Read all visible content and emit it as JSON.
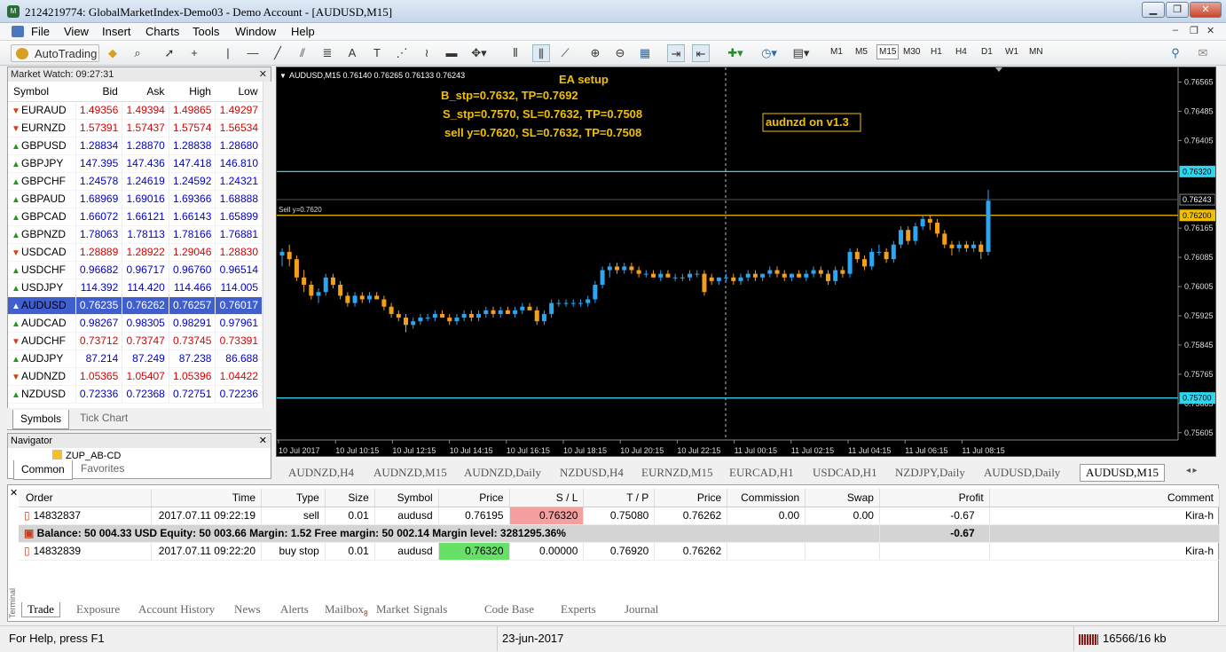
{
  "window": {
    "title": "2124219774: GlobalMarketIndex-Demo03 - Demo Account - [AUDUSD,M15]"
  },
  "menu": [
    "File",
    "View",
    "Insert",
    "Charts",
    "Tools",
    "Window",
    "Help"
  ],
  "toolbar": {
    "autotrading": "AutoTrading",
    "timeframes": [
      "M1",
      "M5",
      "M15",
      "M30",
      "H1",
      "H4",
      "D1",
      "W1",
      "MN"
    ],
    "active_tf": "M15"
  },
  "market_watch": {
    "title": "Market Watch: 09:27:31",
    "headers": [
      "Symbol",
      "Bid",
      "Ask",
      "High",
      "Low"
    ],
    "rows": [
      {
        "sym": "EURAUD",
        "bid": "1.49356",
        "ask": "1.49394",
        "high": "1.49865",
        "low": "1.49297",
        "dir": "down"
      },
      {
        "sym": "EURNZD",
        "bid": "1.57391",
        "ask": "1.57437",
        "high": "1.57574",
        "low": "1.56534",
        "dir": "down"
      },
      {
        "sym": "GBPUSD",
        "bid": "1.28834",
        "ask": "1.28870",
        "high": "1.28838",
        "low": "1.28680",
        "dir": "up"
      },
      {
        "sym": "GBPJPY",
        "bid": "147.395",
        "ask": "147.436",
        "high": "147.418",
        "low": "146.810",
        "dir": "up"
      },
      {
        "sym": "GBPCHF",
        "bid": "1.24578",
        "ask": "1.24619",
        "high": "1.24592",
        "low": "1.24321",
        "dir": "up"
      },
      {
        "sym": "GBPAUD",
        "bid": "1.68969",
        "ask": "1.69016",
        "high": "1.69366",
        "low": "1.68888",
        "dir": "up"
      },
      {
        "sym": "GBPCAD",
        "bid": "1.66072",
        "ask": "1.66121",
        "high": "1.66143",
        "low": "1.65899",
        "dir": "up"
      },
      {
        "sym": "GBPNZD",
        "bid": "1.78063",
        "ask": "1.78113",
        "high": "1.78166",
        "low": "1.76881",
        "dir": "up"
      },
      {
        "sym": "USDCAD",
        "bid": "1.28889",
        "ask": "1.28922",
        "high": "1.29046",
        "low": "1.28830",
        "dir": "down"
      },
      {
        "sym": "USDCHF",
        "bid": "0.96682",
        "ask": "0.96717",
        "high": "0.96760",
        "low": "0.96514",
        "dir": "up"
      },
      {
        "sym": "USDJPY",
        "bid": "114.392",
        "ask": "114.420",
        "high": "114.466",
        "low": "114.005",
        "dir": "up"
      },
      {
        "sym": "AUDUSD",
        "bid": "0.76235",
        "ask": "0.76262",
        "high": "0.76257",
        "low": "0.76017",
        "dir": "up",
        "selected": true
      },
      {
        "sym": "AUDCAD",
        "bid": "0.98267",
        "ask": "0.98305",
        "high": "0.98291",
        "low": "0.97961",
        "dir": "up"
      },
      {
        "sym": "AUDCHF",
        "bid": "0.73712",
        "ask": "0.73747",
        "high": "0.73745",
        "low": "0.73391",
        "dir": "down"
      },
      {
        "sym": "AUDJPY",
        "bid": "87.214",
        "ask": "87.249",
        "high": "87.238",
        "low": "86.688",
        "dir": "up"
      },
      {
        "sym": "AUDNZD",
        "bid": "1.05365",
        "ask": "1.05407",
        "high": "1.05396",
        "low": "1.04422",
        "dir": "down"
      },
      {
        "sym": "NZDUSD",
        "bid": "0.72336",
        "ask": "0.72368",
        "high": "0.72751",
        "low": "0.72236",
        "dir": "up"
      }
    ],
    "tabs": [
      "Symbols",
      "Tick Chart"
    ]
  },
  "navigator": {
    "title": "Navigator",
    "item": "ZUP_AB-CD",
    "tabs": [
      "Common",
      "Favorites"
    ]
  },
  "chart": {
    "header": "AUDUSD,M15  0.76140 0.76265 0.76133 0.76243",
    "ea_setup": [
      "EA setup",
      "B_stp=0.7632, TP=0.7692",
      "S_stp=0.7570, SL=0.7632, TP=0.7508",
      "sell y=0.7620, SL=0.7632, TP=0.7508"
    ],
    "note": "audnzd on v1.3",
    "sell_label": "Sell y=0.7620",
    "price_axis": [
      "0.76565",
      "0.76485",
      "0.76405",
      "0.76165",
      "0.76085",
      "0.76005",
      "0.75925",
      "0.75845",
      "0.75765",
      "0.75685",
      "0.75605"
    ],
    "price_tags": {
      "upper": "0.76320",
      "current": "0.76243",
      "sell": "0.76200",
      "lower": "0.75700"
    },
    "time_axis": [
      "10 Jul 2017",
      "10 Jul 10:15",
      "10 Jul 12:15",
      "10 Jul 14:15",
      "10 Jul 16:15",
      "10 Jul 18:15",
      "10 Jul 20:15",
      "10 Jul 22:15",
      "11 Jul 00:15",
      "11 Jul 02:15",
      "11 Jul 04:15",
      "11 Jul 06:15",
      "11 Jul 08:15"
    ],
    "colors": {
      "bull": "#2aa6f2",
      "bear": "#f2a01a",
      "cyan": "#2fd6f0",
      "gold": "#f0c000"
    }
  },
  "chart_tabs": [
    "AUDNZD,H4",
    "AUDNZD,M15",
    "AUDNZD,Daily",
    "NZDUSD,H4",
    "EURNZD,M15",
    "EURCAD,H1",
    "USDCAD,H1",
    "NZDJPY,Daily",
    "AUDUSD,Daily",
    "AUDUSD,M15"
  ],
  "terminal": {
    "headers": [
      "Order",
      "Time",
      "Type",
      "Size",
      "Symbol",
      "Price",
      "S / L",
      "T / P",
      "Price",
      "Commission",
      "Swap",
      "Profit",
      "Comment"
    ],
    "orders": [
      {
        "order": "14832837",
        "time": "2017.07.11 09:22:19",
        "type": "sell",
        "size": "0.01",
        "symbol": "audusd",
        "price": "0.76195",
        "sl": "0.76320",
        "tp": "0.75080",
        "cur": "0.76262",
        "commission": "0.00",
        "swap": "0.00",
        "profit": "-0.67",
        "comment": "Kira-h"
      },
      {
        "order": "14832839",
        "time": "2017.07.11 09:22:20",
        "type": "buy stop",
        "size": "0.01",
        "symbol": "audusd",
        "price": "0.76320",
        "sl": "0.00000",
        "tp": "0.76920",
        "cur": "0.76262",
        "commission": "",
        "swap": "",
        "profit": "",
        "comment": "Kira-h"
      }
    ],
    "balance": "Balance: 50 004.33 USD  Equity: 50 003.66  Margin: 1.52  Free margin: 50 002.14  Margin level: 3281295.36%",
    "balance_profit": "-0.67",
    "tabs": [
      "Trade",
      "Exposure",
      "Account History",
      "News",
      "Alerts",
      "Mailbox",
      "Market",
      "Signals",
      "Code Base",
      "Experts",
      "Journal"
    ],
    "mailbox_badge": "8",
    "side_label": "Terminal"
  },
  "status": {
    "help": "For Help, press F1",
    "date": "23-jun-2017",
    "traffic": "16566/16 kb"
  },
  "candles": [
    [
      0.7609,
      0.7611,
      0.7606,
      0.761
    ],
    [
      0.761,
      0.7612,
      0.7606,
      0.7608
    ],
    [
      0.7608,
      0.7609,
      0.7602,
      0.7603
    ],
    [
      0.7603,
      0.7605,
      0.7599,
      0.7601
    ],
    [
      0.7601,
      0.7602,
      0.7597,
      0.7598
    ],
    [
      0.7598,
      0.76,
      0.7596,
      0.7599
    ],
    [
      0.7599,
      0.7604,
      0.7598,
      0.7603
    ],
    [
      0.7603,
      0.7604,
      0.76,
      0.7601
    ],
    [
      0.7601,
      0.7602,
      0.7597,
      0.7598
    ],
    [
      0.7598,
      0.7599,
      0.7595,
      0.7596
    ],
    [
      0.7596,
      0.7599,
      0.7595,
      0.7598
    ],
    [
      0.7598,
      0.7599,
      0.7596,
      0.7597
    ],
    [
      0.7597,
      0.7599,
      0.7596,
      0.7598
    ],
    [
      0.7598,
      0.7599,
      0.7597,
      0.7597
    ],
    [
      0.7597,
      0.7598,
      0.7594,
      0.7595
    ],
    [
      0.7595,
      0.7596,
      0.7592,
      0.7593
    ],
    [
      0.7593,
      0.7594,
      0.7591,
      0.7592
    ],
    [
      0.7592,
      0.7593,
      0.7588,
      0.759
    ],
    [
      0.759,
      0.7592,
      0.7589,
      0.7591
    ],
    [
      0.7591,
      0.7593,
      0.759,
      0.7592
    ],
    [
      0.7592,
      0.7593,
      0.7591,
      0.7592
    ],
    [
      0.7592,
      0.7594,
      0.7591,
      0.7593
    ],
    [
      0.7593,
      0.7594,
      0.7592,
      0.7592
    ],
    [
      0.7592,
      0.7593,
      0.759,
      0.7591
    ],
    [
      0.7591,
      0.7593,
      0.759,
      0.7592
    ],
    [
      0.7592,
      0.7594,
      0.7591,
      0.7593
    ],
    [
      0.7593,
      0.7594,
      0.7591,
      0.7592
    ],
    [
      0.7592,
      0.7594,
      0.7591,
      0.7593
    ],
    [
      0.7593,
      0.7595,
      0.7592,
      0.7594
    ],
    [
      0.7594,
      0.7595,
      0.7592,
      0.7593
    ],
    [
      0.7593,
      0.7595,
      0.7592,
      0.7594
    ],
    [
      0.7594,
      0.7595,
      0.7593,
      0.7593
    ],
    [
      0.7593,
      0.7595,
      0.7592,
      0.7594
    ],
    [
      0.7594,
      0.7596,
      0.7593,
      0.7595
    ],
    [
      0.7595,
      0.7596,
      0.7594,
      0.7594
    ],
    [
      0.7594,
      0.7595,
      0.759,
      0.7591
    ],
    [
      0.7591,
      0.7594,
      0.759,
      0.7593
    ],
    [
      0.7593,
      0.7597,
      0.7592,
      0.7596
    ],
    [
      0.7596,
      0.7597,
      0.7595,
      0.7596
    ],
    [
      0.7596,
      0.7597,
      0.7595,
      0.7596
    ],
    [
      0.7596,
      0.7597,
      0.7595,
      0.7596
    ],
    [
      0.7596,
      0.7597,
      0.7595,
      0.7596
    ],
    [
      0.7596,
      0.7598,
      0.7595,
      0.7597
    ],
    [
      0.7597,
      0.7602,
      0.7596,
      0.7601
    ],
    [
      0.7601,
      0.7606,
      0.76,
      0.7605
    ],
    [
      0.7605,
      0.7607,
      0.7603,
      0.7606
    ],
    [
      0.7606,
      0.7607,
      0.7604,
      0.7605
    ],
    [
      0.7605,
      0.7607,
      0.7604,
      0.7606
    ],
    [
      0.7606,
      0.7607,
      0.7604,
      0.7605
    ],
    [
      0.7605,
      0.7606,
      0.7603,
      0.7604
    ],
    [
      0.7604,
      0.7605,
      0.7603,
      0.7604
    ],
    [
      0.7604,
      0.7605,
      0.7603,
      0.7603
    ],
    [
      0.7603,
      0.7605,
      0.7602,
      0.7604
    ],
    [
      0.7604,
      0.7605,
      0.7603,
      0.7603
    ],
    [
      0.7603,
      0.7604,
      0.7602,
      0.7603
    ],
    [
      0.7603,
      0.7604,
      0.7602,
      0.7603
    ],
    [
      0.7603,
      0.7605,
      0.7602,
      0.7604
    ],
    [
      0.7604,
      0.7605,
      0.7603,
      0.7604
    ],
    [
      0.7604,
      0.7605,
      0.7598,
      0.7599
    ],
    [
      0.7603,
      0.7604,
      0.7601,
      0.7602
    ],
    [
      0.7602,
      0.7603,
      0.7601,
      0.7603
    ],
    [
      0.7603,
      0.7604,
      0.7602,
      0.7603
    ],
    [
      0.7603,
      0.7604,
      0.7601,
      0.7602
    ],
    [
      0.7602,
      0.7604,
      0.7601,
      0.7603
    ],
    [
      0.7603,
      0.7605,
      0.7602,
      0.7604
    ],
    [
      0.7604,
      0.7605,
      0.7602,
      0.7603
    ],
    [
      0.7603,
      0.7604,
      0.7602,
      0.7604
    ],
    [
      0.7604,
      0.7606,
      0.7603,
      0.7605
    ],
    [
      0.7605,
      0.7606,
      0.7603,
      0.7604
    ],
    [
      0.7604,
      0.7605,
      0.7602,
      0.7603
    ],
    [
      0.7603,
      0.7604,
      0.7602,
      0.7604
    ],
    [
      0.7604,
      0.7605,
      0.7603,
      0.7603
    ],
    [
      0.7603,
      0.7605,
      0.7602,
      0.7604
    ],
    [
      0.7604,
      0.7606,
      0.7603,
      0.7605
    ],
    [
      0.7605,
      0.7606,
      0.7603,
      0.7604
    ],
    [
      0.7604,
      0.7605,
      0.7601,
      0.7602
    ],
    [
      0.7602,
      0.7606,
      0.7601,
      0.7605
    ],
    [
      0.7605,
      0.7606,
      0.7603,
      0.7604
    ],
    [
      0.7604,
      0.7611,
      0.7603,
      0.761
    ],
    [
      0.761,
      0.7611,
      0.7607,
      0.7608
    ],
    [
      0.7608,
      0.7609,
      0.7605,
      0.7606
    ],
    [
      0.7606,
      0.7611,
      0.7605,
      0.761
    ],
    [
      0.761,
      0.7612,
      0.7609,
      0.761
    ],
    [
      0.761,
      0.7611,
      0.7607,
      0.7608
    ],
    [
      0.7608,
      0.7613,
      0.7607,
      0.7612
    ],
    [
      0.7612,
      0.7617,
      0.7611,
      0.7616
    ],
    [
      0.7616,
      0.7617,
      0.7612,
      0.7613
    ],
    [
      0.7613,
      0.7618,
      0.7612,
      0.7617
    ],
    [
      0.7617,
      0.762,
      0.7616,
      0.7619
    ],
    [
      0.7619,
      0.762,
      0.7616,
      0.7618
    ],
    [
      0.7618,
      0.7619,
      0.7614,
      0.7615
    ],
    [
      0.7615,
      0.7616,
      0.7611,
      0.7612
    ],
    [
      0.7612,
      0.7613,
      0.7609,
      0.7611
    ],
    [
      0.7611,
      0.7613,
      0.761,
      0.7612
    ],
    [
      0.7612,
      0.7613,
      0.761,
      0.7611
    ],
    [
      0.7611,
      0.7613,
      0.761,
      0.7612
    ],
    [
      0.7612,
      0.7613,
      0.7608,
      0.761
    ],
    [
      0.761,
      0.7627,
      0.7609,
      0.7624
    ]
  ]
}
